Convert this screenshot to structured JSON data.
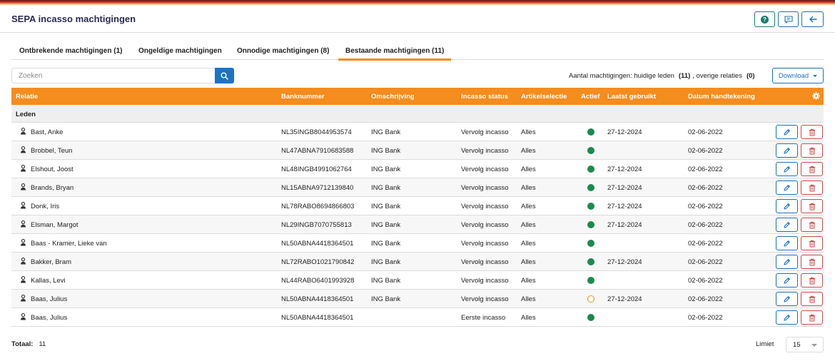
{
  "header": {
    "title": "SEPA incasso machtigingen"
  },
  "tabs": [
    {
      "label": "Ontbrekende machtigingen (1)"
    },
    {
      "label": "Ongeldige machtigingen"
    },
    {
      "label": "Onnodige machtigingen (8)"
    },
    {
      "label": "Bestaande machtigingen (11)"
    }
  ],
  "search": {
    "placeholder": "Zoeken"
  },
  "summary": {
    "prefix": "Aantal machtigingen: huidige leden",
    "members_count": "(11)",
    "middle": ", overige relaties",
    "others_count": "(0)"
  },
  "download_label": "Download",
  "table": {
    "headers": {
      "relatie": "Relatie",
      "banknummer": "Banknummer",
      "omschrijving": "Omschrijving",
      "status": "Incasso status",
      "artikel": "Artikelselectie",
      "actief": "Actief",
      "laatst": "Laatst gebruikt",
      "datum": "Datum handtekening"
    },
    "group_label": "Leden",
    "rows": [
      {
        "name": "Bast, Anke",
        "bank": "NL35INGB8044953574",
        "desc": "ING Bank",
        "status": "Vervolg incasso",
        "artikel": "Alles",
        "actief": "green",
        "laatst": "27-12-2024",
        "datum": "02-06-2022"
      },
      {
        "name": "Brobbel, Teun",
        "bank": "NL47ABNA7910683588",
        "desc": "ING Bank",
        "status": "Vervolg incasso",
        "artikel": "Alles",
        "actief": "green",
        "laatst": "",
        "datum": "02-06-2022"
      },
      {
        "name": "Elshout, Joost",
        "bank": "NL48INGB4991062764",
        "desc": "ING Bank",
        "status": "Vervolg incasso",
        "artikel": "Alles",
        "actief": "green",
        "laatst": "27-12-2024",
        "datum": "02-06-2022"
      },
      {
        "name": "Brands, Bryan",
        "bank": "NL15ABNA9712139840",
        "desc": "ING Bank",
        "status": "Vervolg incasso",
        "artikel": "Alles",
        "actief": "green",
        "laatst": "27-12-2024",
        "datum": "02-06-2022"
      },
      {
        "name": "Donk, Iris",
        "bank": "NL78RABO8694866803",
        "desc": "ING Bank",
        "status": "Vervolg incasso",
        "artikel": "Alles",
        "actief": "green",
        "laatst": "27-12-2024",
        "datum": "02-06-2022"
      },
      {
        "name": "Elsman, Margot",
        "bank": "NL29INGB7070755813",
        "desc": "ING Bank",
        "status": "Vervolg incasso",
        "artikel": "Alles",
        "actief": "green",
        "laatst": "27-12-2024",
        "datum": "02-06-2022"
      },
      {
        "name": "Baas - Kramer, Lieke van",
        "bank": "NL50ABNA4418364501",
        "desc": "ING Bank",
        "status": "Vervolg incasso",
        "artikel": "Alles",
        "actief": "green",
        "laatst": "",
        "datum": "02-06-2022"
      },
      {
        "name": "Bakker, Bram",
        "bank": "NL72RABO1021790842",
        "desc": "ING Bank",
        "status": "Vervolg incasso",
        "artikel": "Alles",
        "actief": "green",
        "laatst": "27-12-2024",
        "datum": "02-06-2022"
      },
      {
        "name": "Kallas, Levi",
        "bank": "NL44RABO6401993928",
        "desc": "ING Bank",
        "status": "Vervolg incasso",
        "artikel": "Alles",
        "actief": "green",
        "laatst": "",
        "datum": "02-06-2022"
      },
      {
        "name": "Baas, Julius",
        "bank": "NL50ABNA4418364501",
        "desc": "ING Bank",
        "status": "Vervolg incasso",
        "artikel": "Alles",
        "actief": "orange-outline",
        "laatst": "27-12-2024",
        "datum": "02-06-2022"
      },
      {
        "name": "Baas, Julius",
        "bank": "NL50ABNA4418364501",
        "desc": "",
        "status": "Eerste incasso",
        "artikel": "Alles",
        "actief": "green",
        "laatst": "",
        "datum": "02-06-2022"
      }
    ]
  },
  "footer": {
    "total_label": "Totaal:",
    "total_value": "11",
    "limit_label": "Limiet",
    "limit_value": "15"
  },
  "colors": {
    "accent": "#f48c1e",
    "primary": "#1b74c4",
    "danger": "#d64545",
    "active": "#1a8a4f",
    "title": "#2b2b55"
  }
}
